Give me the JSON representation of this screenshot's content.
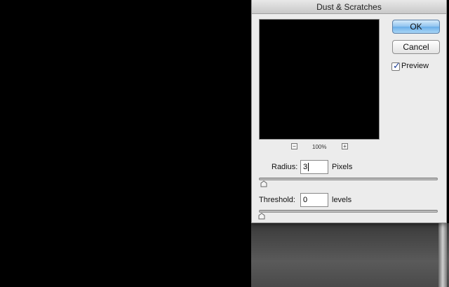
{
  "dialog": {
    "title": "Dust & Scratches",
    "ok_label": "OK",
    "cancel_label": "Cancel",
    "preview_label": "Preview",
    "preview_checked": true,
    "zoom_level": "100%",
    "zoom_out_symbol": "−",
    "zoom_in_symbol": "+"
  },
  "radius": {
    "label": "Radius:",
    "value": "3",
    "unit": "Pixels",
    "slider_fraction": 0.01
  },
  "threshold": {
    "label": "Threshold:",
    "value": "0",
    "unit": "levels",
    "slider_fraction": 0.0
  },
  "colors": {
    "dialog_bg": "#ececec",
    "default_button": "#8fc3ee",
    "canvas": "#000000"
  }
}
